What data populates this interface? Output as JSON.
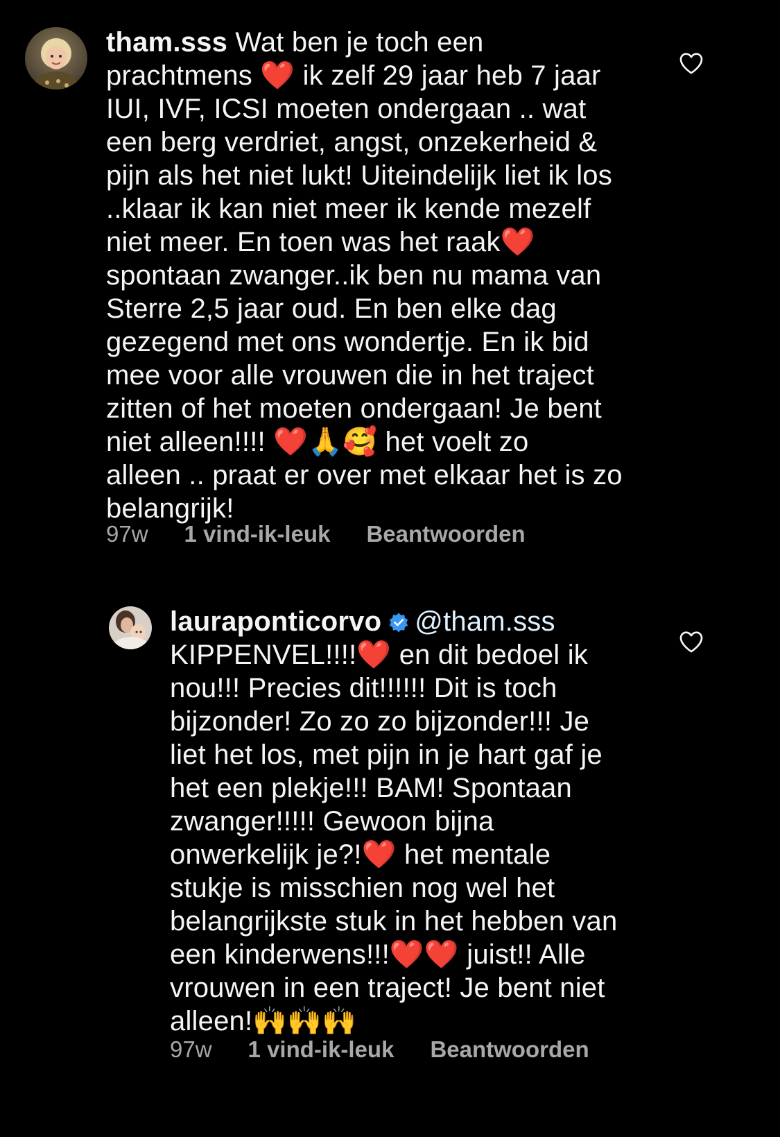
{
  "comments": [
    {
      "username": "tham.sss",
      "verified": false,
      "mention": "",
      "text": "Wat ben je toch een\nprachtmens ❤️  ik zelf 29 jaar heb 7 jaar\nIUI, IVF, ICSI moeten ondergaan .. wat\neen berg verdriet, angst, onzekerheid &\npijn als het niet lukt! Uiteindelijk liet ik los\n..klaar ik kan niet meer ik kende mezelf\nniet meer. En toen was het raak❤️\nspontaan zwanger..ik ben nu mama van\nSterre 2,5 jaar oud. En ben elke dag\ngezegend met ons wondertje. En ik bid\nmee voor alle vrouwen die in het traject\nzitten of het moeten ondergaan! Je bent\nniet alleen!!!! ❤️🙏🥰 het voelt zo\nalleen .. praat er over met elkaar het is zo\nbelangrijk!",
      "time": "97w",
      "likes": "1 vind-ik-leuk",
      "reply": "Beantwoorden",
      "avatar_icon": "child-portrait-avatar"
    },
    {
      "username": "lauraponticorvo",
      "verified": true,
      "mention": "@tham.sss",
      "text": "KIPPENVEL!!!!❤️  en dit bedoel ik\nnou!!! Precies dit!!!!!! Dit is toch\nbijzonder! Zo zo zo bijzonder!!! Je\nliet het los, met pijn in je hart gaf je\nhet een plekje!!! BAM! Spontaan\nzwanger!!!!! Gewoon bijna\nonwerkelijk je?!❤️  het mentale\nstukje is misschien nog wel het\nbelangrijkste stuk in het hebben van\neen kinderwens!!!❤️❤️  juist!! Alle\nvrouwen in een traject! Je bent niet\nalleen!🙌🙌🙌",
      "time": "97w",
      "likes": "1 vind-ik-leuk",
      "reply": "Beantwoorden",
      "avatar_icon": "family-photo-avatar"
    }
  ],
  "colors": {
    "background": "#000000",
    "text": "#f5f5f5",
    "meta": "#a8a8a8",
    "verified": "#3897f0",
    "heart_outline": "#f5f5f5"
  },
  "icons": {
    "like": "heart-outline-icon",
    "verified": "verified-badge-icon"
  }
}
